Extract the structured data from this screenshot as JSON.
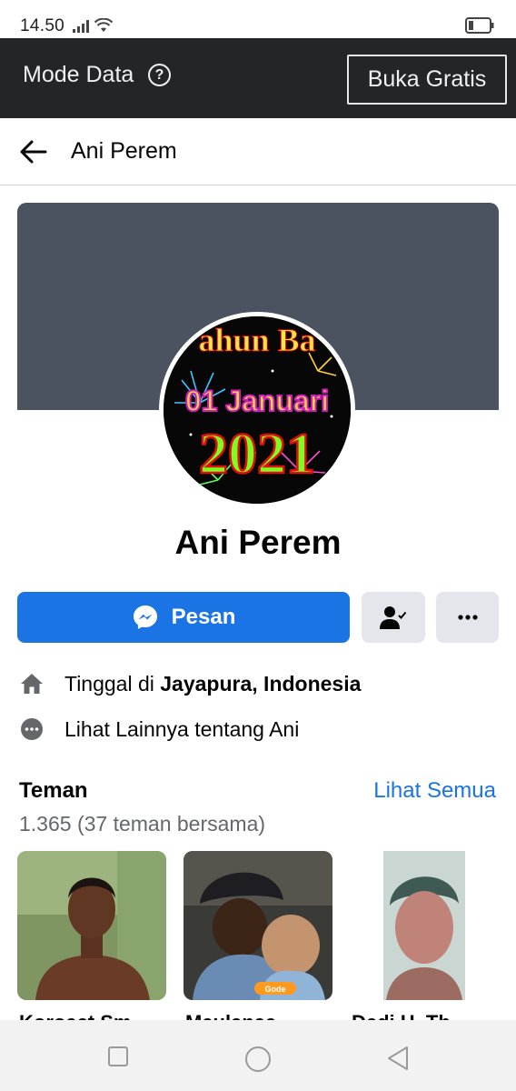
{
  "status_bar": {
    "time": "14.50"
  },
  "data_bar": {
    "label": "Mode Data",
    "help_symbol": "?",
    "open_free_label": "Buka Gratis"
  },
  "nav": {
    "title": "Ani Perem"
  },
  "profile": {
    "name": "Ani Perem",
    "avatar_text": {
      "line1": "ahun Ba",
      "line2": "01 Januari",
      "line3": "2021"
    }
  },
  "actions": {
    "message_label": "Pesan"
  },
  "info": {
    "lives_prefix": "Tinggal di ",
    "lives_place": "Jayapura, Indonesia",
    "see_more": "Lihat Lainnya tentang Ani"
  },
  "friends": {
    "title": "Teman",
    "see_all": "Lihat Semua",
    "count": "1.365 (37 teman bersama)",
    "cards": [
      {
        "name": "Koroact Sm",
        "badge": ""
      },
      {
        "name": "Maulanaa",
        "badge": "Gode"
      },
      {
        "name": "Dedi H. Th",
        "badge": ""
      }
    ]
  },
  "colors": {
    "accent": "#1b74e4",
    "data_bar": "#242526",
    "cover": "#4b5260",
    "secondary_button": "#e4e6eb"
  }
}
